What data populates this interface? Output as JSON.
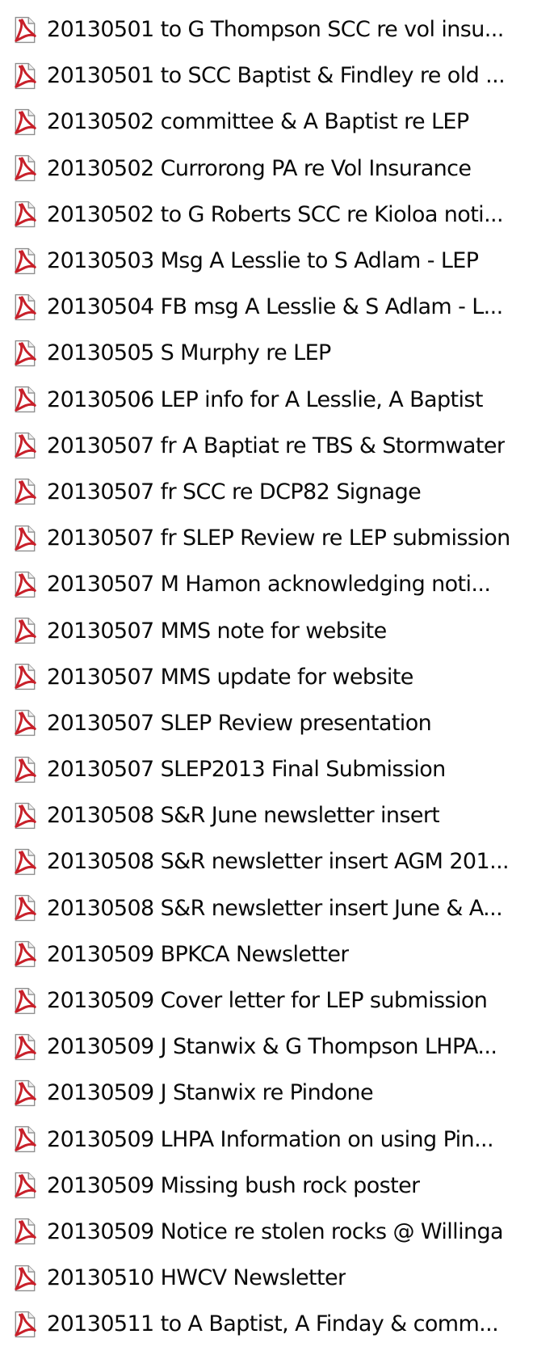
{
  "icons": {
    "file_icon": "pdf-file-icon",
    "accent": "#c8202a"
  },
  "files": [
    {
      "name": "20130501 to G Thompson SCC re vol insu..."
    },
    {
      "name": "20130501 to SCC Baptist & Findley re old ..."
    },
    {
      "name": "20130502 committee & A Baptist re LEP"
    },
    {
      "name": "20130502 Currorong PA re Vol Insurance"
    },
    {
      "name": "20130502 to G Roberts SCC re Kioloa noti..."
    },
    {
      "name": "20130503 Msg A Lesslie to S Adlam - LEP"
    },
    {
      "name": "20130504 FB msg A Lesslie & S Adlam - L..."
    },
    {
      "name": "20130505 S Murphy re LEP"
    },
    {
      "name": "20130506 LEP info for A Lesslie, A Baptist"
    },
    {
      "name": "20130507 fr A Baptiat re TBS & Stormwater"
    },
    {
      "name": "20130507 fr SCC re DCP82 Signage"
    },
    {
      "name": "20130507 fr SLEP Review re LEP submission"
    },
    {
      "name": "20130507 M Hamon acknowledging noti..."
    },
    {
      "name": "20130507 MMS note for website"
    },
    {
      "name": "20130507 MMS update for website"
    },
    {
      "name": "20130507 SLEP Review presentation"
    },
    {
      "name": "20130507 SLEP2013 Final Submission"
    },
    {
      "name": "20130508 S&R June  newsletter insert"
    },
    {
      "name": "20130508 S&R newsletter insert AGM 201..."
    },
    {
      "name": "20130508 S&R newsletter insert June & A..."
    },
    {
      "name": "20130509 BPKCA Newsletter"
    },
    {
      "name": "20130509 Cover letter for LEP submission"
    },
    {
      "name": "20130509 J Stanwix & G Thompson LHPA..."
    },
    {
      "name": "20130509 J Stanwix re Pindone"
    },
    {
      "name": "20130509 LHPA Information on using Pin..."
    },
    {
      "name": "20130509 Missing bush rock poster"
    },
    {
      "name": "20130509 Notice re stolen rocks @ Willinga"
    },
    {
      "name": "20130510 HWCV Newsletter"
    },
    {
      "name": "20130511 to A Baptist, A Finday & comm..."
    }
  ]
}
